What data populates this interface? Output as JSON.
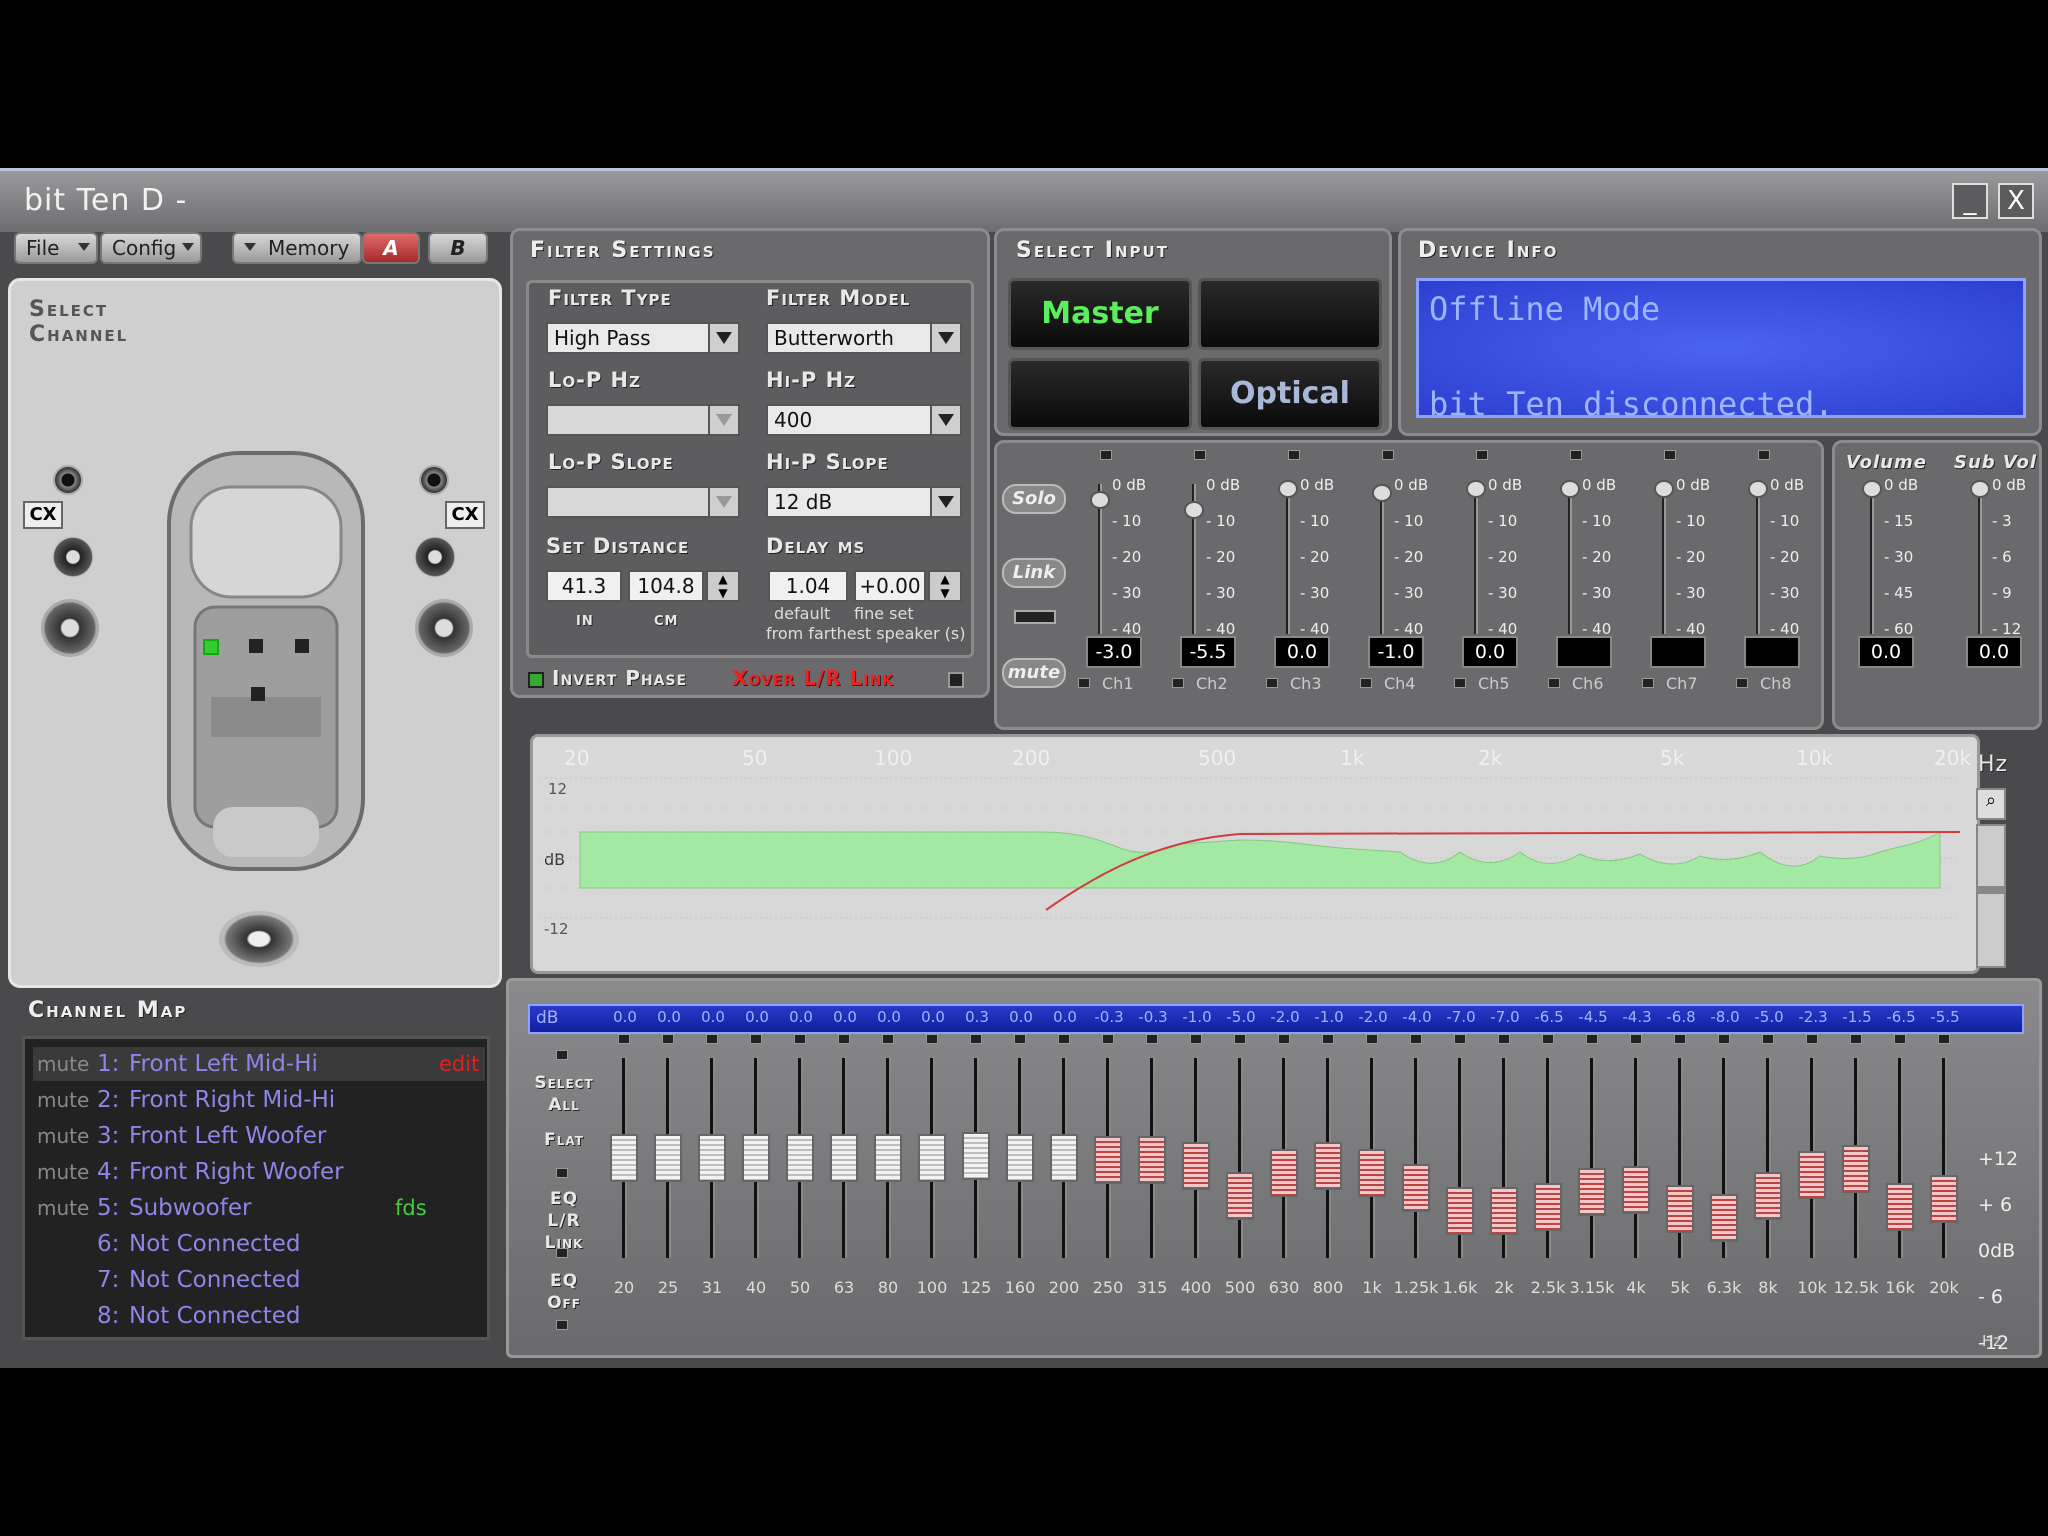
{
  "app": {
    "title": "bit Ten D -",
    "minimize": "_",
    "close": "X"
  },
  "menu": {
    "file": "File",
    "config": "Config",
    "memory": "Memory",
    "a": "A",
    "b": "B"
  },
  "select_channel": {
    "heading_line1": "Select",
    "heading_line2": "Channel",
    "cx_left": "CX",
    "cx_right": "CX"
  },
  "filter": {
    "heading": "Filter Settings",
    "filter_type_label": "Filter Type",
    "filter_type": "High Pass",
    "filter_model_label": "Filter Model",
    "filter_model": "Butterworth",
    "lop_hz_label": "Lo-P Hz",
    "lop_hz": "",
    "hip_hz_label": "Hi-P Hz",
    "hip_hz": "400",
    "lop_slope_label": "Lo-P Slope",
    "lop_slope": "",
    "hip_slope_label": "Hi-P Slope",
    "hip_slope": "12 dB",
    "distance_label": "Set Distance",
    "dist_in": "41.3",
    "dist_cm": "104.8",
    "unit_in": "in",
    "unit_cm": "cm",
    "delay_label": "Delay ms",
    "delay": "1.04",
    "fine": "+0.00",
    "default_lbl": "default",
    "fine_lbl": "fine set",
    "from_lbl": "from farthest speaker (s)",
    "invert_phase": "Invert Phase",
    "xover_link": "Xover L/R Link"
  },
  "input": {
    "heading": "Select Input",
    "master": "Master",
    "optical": "Optical"
  },
  "device": {
    "heading": "Device Info",
    "line1": "Offline Mode",
    "line2": "bit Ten disconnected."
  },
  "mixer": {
    "solo": "Solo",
    "link": "Link",
    "mute": "mute",
    "volume_label": "Volume",
    "subvol_label": "Sub Vol",
    "channels": [
      {
        "name": "Ch1",
        "value": "-3.0",
        "level": 0.075
      },
      {
        "name": "Ch2",
        "value": "-5.5",
        "level": 0.1375
      },
      {
        "name": "Ch3",
        "value": "0.0",
        "level": 0
      },
      {
        "name": "Ch4",
        "value": "-1.0",
        "level": 0.025
      },
      {
        "name": "Ch5",
        "value": "0.0",
        "level": 0
      },
      {
        "name": "Ch6",
        "value": "",
        "level": 0
      },
      {
        "name": "Ch7",
        "value": "",
        "level": 0
      },
      {
        "name": "Ch8",
        "value": "",
        "level": 0
      }
    ],
    "scale": [
      "0 dB",
      "- 10",
      "- 20",
      "- 30",
      "- 40"
    ],
    "volume": {
      "value": "0.0",
      "scale": [
        "0 dB",
        "- 15",
        "- 30",
        "- 45",
        "- 60"
      ]
    },
    "subvol": {
      "value": "0.0",
      "scale": [
        "0 dB",
        "- 3",
        "- 6",
        "- 9",
        "- 12"
      ]
    }
  },
  "graph": {
    "freqs": [
      "20",
      "50",
      "100",
      "200",
      "500",
      "1k",
      "2k",
      "5k",
      "10k",
      "20k"
    ],
    "hz": "Hz",
    "y_labels": [
      "12",
      "dB",
      "-12"
    ]
  },
  "channel_map": {
    "heading": "Channel Map",
    "rows": [
      {
        "mute": "mute",
        "num": "1:",
        "name": "Front Left Mid-Hi",
        "extra": "edit"
      },
      {
        "mute": "mute",
        "num": "2:",
        "name": "Front Right Mid-Hi",
        "extra": ""
      },
      {
        "mute": "mute",
        "num": "3:",
        "name": "Front Left Woofer",
        "extra": ""
      },
      {
        "mute": "mute",
        "num": "4:",
        "name": "Front Right Woofer",
        "extra": ""
      },
      {
        "mute": "mute",
        "num": "5:",
        "name": "Subwoofer",
        "extra": "fds"
      },
      {
        "mute": "",
        "num": "6:",
        "name": "Not Connected",
        "extra": ""
      },
      {
        "mute": "",
        "num": "7:",
        "name": "Not Connected",
        "extra": ""
      },
      {
        "mute": "",
        "num": "8:",
        "name": "Not Connected",
        "extra": ""
      }
    ]
  },
  "eq": {
    "db_label": "dB",
    "hz_label": "Hz",
    "select_all": "Select All",
    "flat": "Flat",
    "eq_lr_link": "EQ L/R Link",
    "eq_off": "EQ Off",
    "scale": [
      "+12",
      "+ 6",
      "0dB",
      "- 6",
      "-12"
    ],
    "bands": [
      {
        "f": "20",
        "v": "0.0",
        "g": 0
      },
      {
        "f": "25",
        "v": "0.0",
        "g": 0
      },
      {
        "f": "31",
        "v": "0.0",
        "g": 0
      },
      {
        "f": "40",
        "v": "0.0",
        "g": 0
      },
      {
        "f": "50",
        "v": "0.0",
        "g": 0
      },
      {
        "f": "63",
        "v": "0.0",
        "g": 0
      },
      {
        "f": "80",
        "v": "0.0",
        "g": 0
      },
      {
        "f": "100",
        "v": "0.0",
        "g": 0
      },
      {
        "f": "125",
        "v": "0.3",
        "g": 0.3
      },
      {
        "f": "160",
        "v": "0.0",
        "g": 0
      },
      {
        "f": "200",
        "v": "0.0",
        "g": 0
      },
      {
        "f": "250",
        "v": "-0.3",
        "g": -0.3
      },
      {
        "f": "315",
        "v": "-0.3",
        "g": -0.3
      },
      {
        "f": "400",
        "v": "-1.0",
        "g": -1.0
      },
      {
        "f": "500",
        "v": "-5.0",
        "g": -5.0
      },
      {
        "f": "630",
        "v": "-2.0",
        "g": -2.0
      },
      {
        "f": "800",
        "v": "-1.0",
        "g": -1.0
      },
      {
        "f": "1k",
        "v": "-2.0",
        "g": -2.0
      },
      {
        "f": "1.25k",
        "v": "-4.0",
        "g": -4.0
      },
      {
        "f": "1.6k",
        "v": "-7.0",
        "g": -7.0
      },
      {
        "f": "2k",
        "v": "-7.0",
        "g": -7.0
      },
      {
        "f": "2.5k",
        "v": "-6.5",
        "g": -6.5
      },
      {
        "f": "3.15k",
        "v": "-4.5",
        "g": -4.5
      },
      {
        "f": "4k",
        "v": "-4.3",
        "g": -4.3
      },
      {
        "f": "5k",
        "v": "-6.8",
        "g": -6.8
      },
      {
        "f": "6.3k",
        "v": "-8.0",
        "g": -8.0
      },
      {
        "f": "8k",
        "v": "-5.0",
        "g": -5.0
      },
      {
        "f": "10k",
        "v": "-2.3",
        "g": -2.3
      },
      {
        "f": "12.5k",
        "v": "-1.5",
        "g": -1.5
      },
      {
        "f": "16k",
        "v": "-6.5",
        "g": -6.5
      },
      {
        "f": "20k",
        "v": "-5.5",
        "g": -5.5
      }
    ]
  }
}
